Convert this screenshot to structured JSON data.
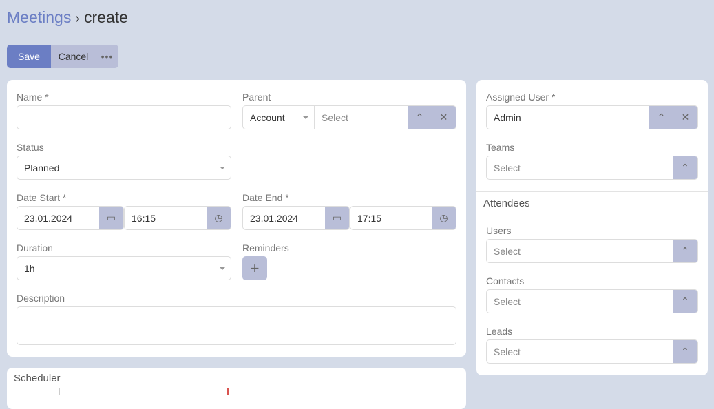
{
  "breadcrumb": {
    "parent": "Meetings",
    "separator": "›",
    "current": "create"
  },
  "toolbar": {
    "save": "Save",
    "cancel": "Cancel",
    "more": "•••"
  },
  "form": {
    "name": {
      "label": "Name *",
      "value": ""
    },
    "parent": {
      "label": "Parent",
      "type": "Account",
      "placeholder": "Select"
    },
    "status": {
      "label": "Status",
      "value": "Planned"
    },
    "date_start": {
      "label": "Date Start *",
      "date": "23.01.2024",
      "time": "16:15"
    },
    "date_end": {
      "label": "Date End *",
      "date": "23.01.2024",
      "time": "17:15"
    },
    "duration": {
      "label": "Duration",
      "value": "1h"
    },
    "reminders": {
      "label": "Reminders",
      "add": "+"
    },
    "description": {
      "label": "Description",
      "value": ""
    }
  },
  "side": {
    "assigned_user": {
      "label": "Assigned User *",
      "value": "Admin"
    },
    "teams": {
      "label": "Teams",
      "placeholder": "Select"
    },
    "attendees_title": "Attendees",
    "users": {
      "label": "Users",
      "placeholder": "Select"
    },
    "contacts": {
      "label": "Contacts",
      "placeholder": "Select"
    },
    "leads": {
      "label": "Leads",
      "placeholder": "Select"
    }
  },
  "scheduler": {
    "title": "Scheduler"
  },
  "icons": {
    "up": "⌃",
    "close": "✕"
  }
}
